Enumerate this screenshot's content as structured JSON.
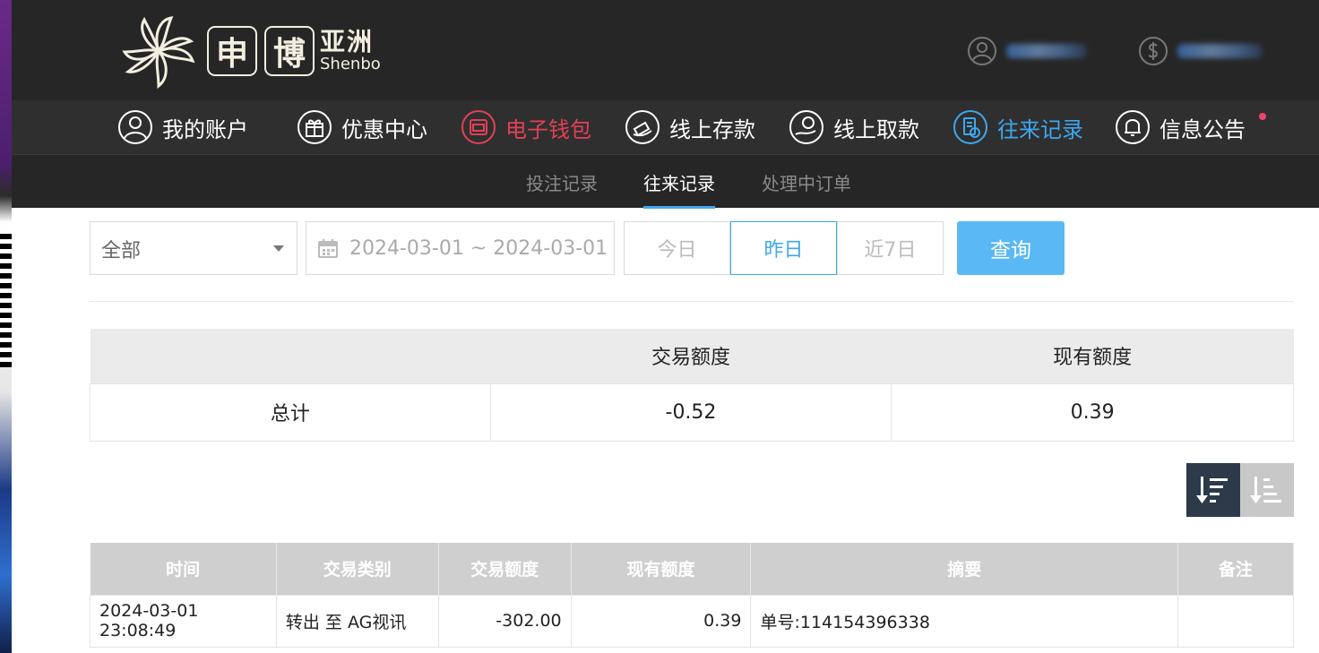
{
  "brand": {
    "cn": "亚洲",
    "en": "Shenbo",
    "char1": "申",
    "char2": "博"
  },
  "nav": {
    "items": [
      {
        "label": "我的账户",
        "icon": "user-icon"
      },
      {
        "label": "优惠中心",
        "icon": "gift-icon"
      },
      {
        "label": "电子钱包",
        "icon": "wallet-icon"
      },
      {
        "label": "线上存款",
        "icon": "deposit-icon"
      },
      {
        "label": "线上取款",
        "icon": "withdraw-icon"
      },
      {
        "label": "往来记录",
        "icon": "record-icon"
      },
      {
        "label": "信息公告",
        "icon": "bell-icon"
      }
    ]
  },
  "subnav": {
    "items": [
      "投注记录",
      "往来记录",
      "处理中订单"
    ],
    "active": "往来记录"
  },
  "filters": {
    "type_selected": "全部",
    "date_range": "2024-03-01 ~ 2024-03-01",
    "quick": [
      "今日",
      "昨日",
      "近7日"
    ],
    "quick_active": "昨日",
    "query_label": "查询"
  },
  "summary": {
    "headers": [
      "",
      "交易额度",
      "现有额度"
    ],
    "row": [
      "总计",
      "-0.52",
      "0.39"
    ]
  },
  "records": {
    "headers": [
      "时间",
      "交易类别",
      "交易额度",
      "现有额度",
      "摘要",
      "备注"
    ],
    "rows": [
      [
        "2024-03-01 23:08:49",
        "转出 至 AG视讯",
        "-302.00",
        "0.39",
        "单号:114154396338",
        ""
      ]
    ]
  },
  "colors": {
    "accent_blue": "#3fa7ee",
    "accent_red": "#e24158",
    "header_bg": "#262626"
  }
}
